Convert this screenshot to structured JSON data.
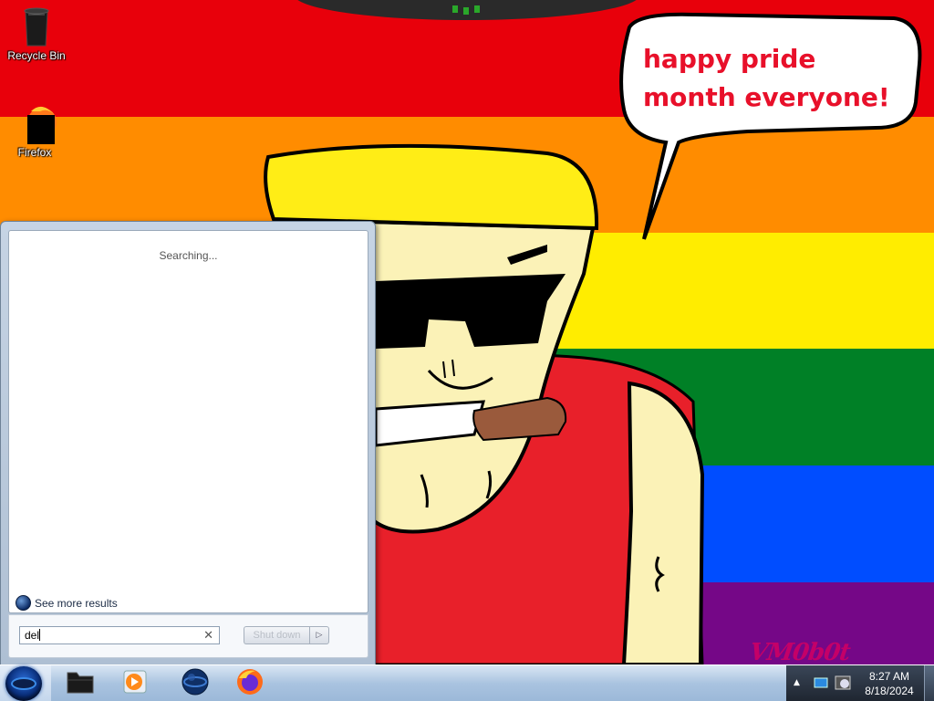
{
  "desktop": {
    "icons": [
      {
        "label": "Recycle Bin",
        "icon": "recycle-bin-icon"
      },
      {
        "label": "Firefox",
        "icon": "firefox-icon"
      }
    ],
    "wallpaper": {
      "speech_bubble": "happy pride month everyone!",
      "signature": "VM0b0t",
      "stripe_colors": [
        "#e8000b",
        "#ff8c00",
        "#ffed00",
        "#008026",
        "#004dff",
        "#750787"
      ]
    }
  },
  "start_menu": {
    "status": "Searching...",
    "see_more_results": "See more results",
    "search": {
      "value": "del",
      "clear_icon": "close-icon"
    },
    "shutdown_label": "Shut down",
    "shutdown_arrow_icon": "arrow-right-icon"
  },
  "taskbar": {
    "pinned": [
      {
        "name": "explorer",
        "icon": "folder-icon"
      },
      {
        "name": "media-player",
        "icon": "media-player-icon"
      },
      {
        "name": "ie",
        "icon": "globe-icon"
      },
      {
        "name": "firefox",
        "icon": "firefox-icon"
      }
    ],
    "tray": {
      "time": "8:27 AM",
      "date": "8/18/2024"
    }
  },
  "colors": {
    "taskbar": "#a9c3e0",
    "start_menu_frame": "#b8c8da",
    "bubble_text": "#e8102a"
  }
}
